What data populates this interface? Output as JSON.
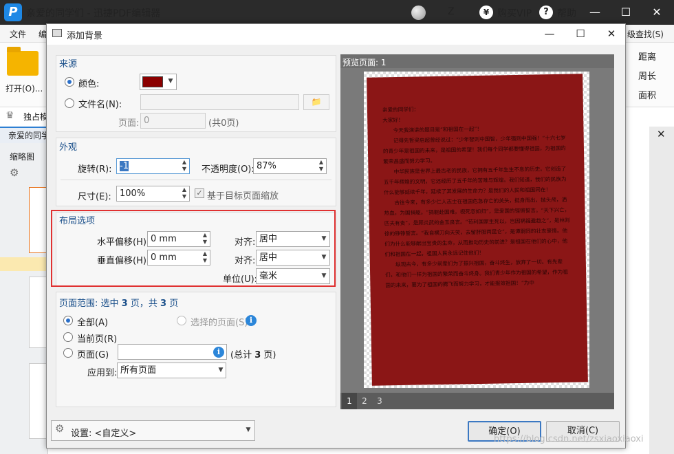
{
  "app": {
    "logo": "P",
    "title": "亲爱的同学们 - 迅捷PDF编辑器",
    "user": "Z",
    "vip": "购买VIP",
    "vip_icon": "¥",
    "help": "帮助",
    "help_icon": "?",
    "menu": [
      "文件",
      "编"
    ],
    "open": "打开(O)...",
    "exclusive": "独占模",
    "doc_tab": "亲爱的同学",
    "thumb_title": "缩略图",
    "find": "级查找(S)",
    "tools": [
      "距离",
      "周长",
      "面积"
    ]
  },
  "dialog": {
    "title": "添加背景",
    "source": {
      "title": "来源",
      "color_label": "颜色:",
      "color_value": "#8b0000",
      "file_label": "文件名(N):",
      "page_label": "页面:",
      "page_value": "0",
      "page_total": "(共0页)"
    },
    "appearance": {
      "title": "外观",
      "rotation_label": "旋转(R):",
      "rotation_value": "-1",
      "opacity_label": "不透明度(O):",
      "opacity_value": "87%",
      "size_label": "尺寸(E):",
      "size_value": "100%",
      "scale_label": "基于目标页面缩放",
      "scale_checked": true
    },
    "layout": {
      "title": "布局选项",
      "h_offset_label": "水平偏移(H):",
      "h_offset_value": "0 mm",
      "v_offset_label": "垂直偏移(H):",
      "v_offset_value": "0 mm",
      "align_label": "对齐:",
      "h_align_value": "居中",
      "v_align_value": "居中",
      "unit_label": "单位(U):",
      "unit_value": "毫米"
    },
    "range": {
      "title_prefix": "页面范围: 选中",
      "selected": "3",
      "title_mid": "页，共",
      "total": "3",
      "title_suffix": "页",
      "all_label": "全部(A)",
      "selected_pages_label": "选择的页面(S)",
      "current_label": "当前页(R)",
      "pages_label": "页面(G)",
      "pages_value": "",
      "pages_total_prefix": "(总计",
      "pages_total_num": "3",
      "pages_total_suffix": "页)",
      "apply_label": "应用到:",
      "apply_value": "所有页面"
    },
    "settings_label": "设置: <自定义>",
    "ok": "确定(O)",
    "cancel": "取消(C)",
    "preview": {
      "title": "预览页面: 1",
      "pages": [
        "1",
        "2",
        "3"
      ],
      "text": [
        "亲爱的同学们：",
        "大家好！",
        "今天我演讲的题目是“和祖国在一起”！",
        "记得先哲梁启超曾经说过：“少年智则中国智，少年强则中国强！”十六七岁的青少年是祖国的未来，是祖国的希望！我们每个同学都要懂得祖国，为祖国的繁荣昌盛而努力学习。",
        "中华民族是世界上最古老的民族，它拥有五千年生生不息的历史。它创造了五千年辉煌的文明，它还经历了五千年的苦难与辉煌。我们知道，我们的民族为什么能够延续千年，延续了其发展的生命力？是我们的人民和祖国同在！",
        "古往今来，有多少仁人志士在祖国危急存亡的关头，挺身而出，抛头颅，洒热血，为国捐躯。“捐躯赴国难，视死忽如归”，是爱国的铿锵誓言。“天下兴亡，匹夫有责”，是顾炎武的金玉良言。“苟利国家生死以，岂因祸福避趋之”，是林则徐的铮铮誓言。“我自横刀向天笑，去留肝胆两昆仑”，是谭嗣同的壮志豪情。他们为什么能够献出宝贵的生命，从而推动历史的前进？是祖国在他们的心中，他们和祖国在一起，祖国人民永远记住他们！",
        "纵观古今，有多少前辈们为了振兴祖国，奋斗终生，放弃了一切。有先辈们，和他们一样为祖国的繁荣而奋斗终身。我们青少年作为祖国的希望，作为祖国的未来，要为了祖国的腾飞而努力学习，才能报效祖国！“为中"
      ]
    }
  },
  "watermark": "https://blog.csdn.net/zsxiaoxiaoxi"
}
